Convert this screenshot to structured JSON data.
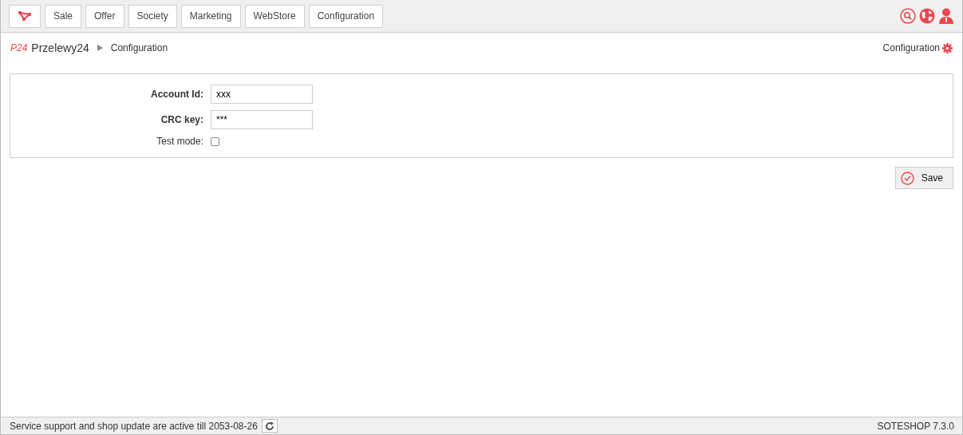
{
  "nav": {
    "items": [
      {
        "label": "Sale"
      },
      {
        "label": "Offer"
      },
      {
        "label": "Society"
      },
      {
        "label": "Marketing"
      },
      {
        "label": "WebStore"
      },
      {
        "label": "Configuration"
      }
    ]
  },
  "breadcrumb": {
    "logo": "P24",
    "module": "Przelewy24",
    "page": "Configuration"
  },
  "config_link": "Configuration",
  "form": {
    "fields": [
      {
        "kind": "text",
        "label": "Account Id:",
        "required": true,
        "value": "xxx"
      },
      {
        "kind": "text",
        "label": "CRC key:",
        "required": true,
        "value": "***"
      },
      {
        "kind": "checkbox",
        "label": "Test mode:",
        "required": false,
        "checked": false
      }
    ]
  },
  "save_button": "Save",
  "status_bar": {
    "message": "Service support and shop update are active till 2053-08-26",
    "version": "SOTESHOP 7.3.0"
  }
}
